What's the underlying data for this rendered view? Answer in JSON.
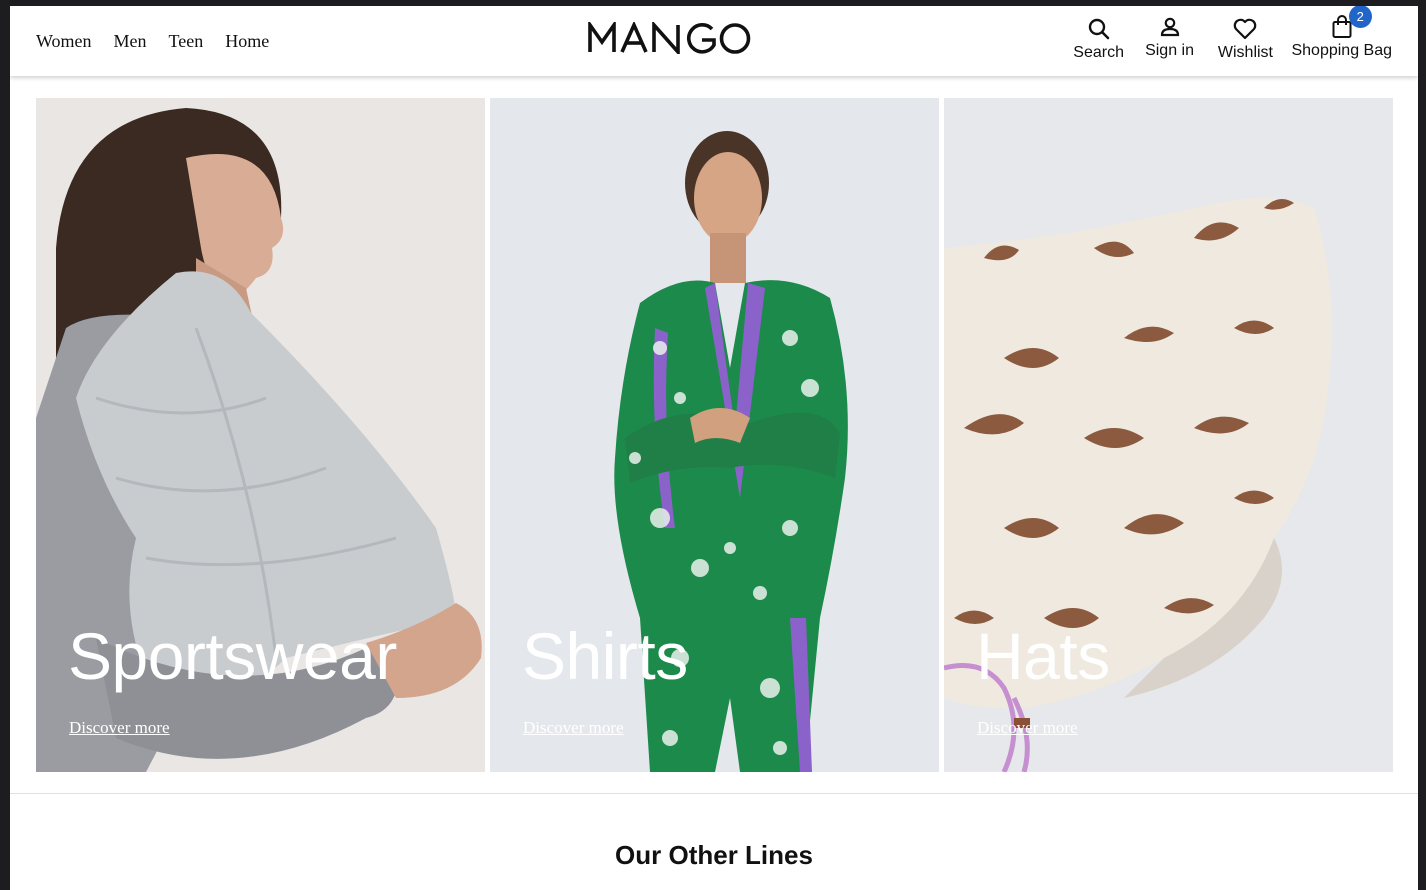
{
  "header": {
    "nav": [
      "Women",
      "Men",
      "Teen",
      "Home"
    ],
    "logo_text": "MANGO",
    "tools": {
      "search": "Search",
      "sign_in": "Sign in",
      "wishlist": "Wishlist",
      "bag": "Shopping Bag",
      "bag_count": "2"
    },
    "badge_color": "#2265c8"
  },
  "tiles": [
    {
      "title": "Sportswear",
      "link": "Discover more",
      "image": "woman in grey quilted vest"
    },
    {
      "title": "Shirts",
      "link": "Discover more",
      "image": "woman in green floral satin shirt and trousers"
    },
    {
      "title": "Hats",
      "link": "Discover more",
      "image": "printed bucket hat with pink drawstring"
    }
  ],
  "section": {
    "title": "Our Other Lines"
  }
}
